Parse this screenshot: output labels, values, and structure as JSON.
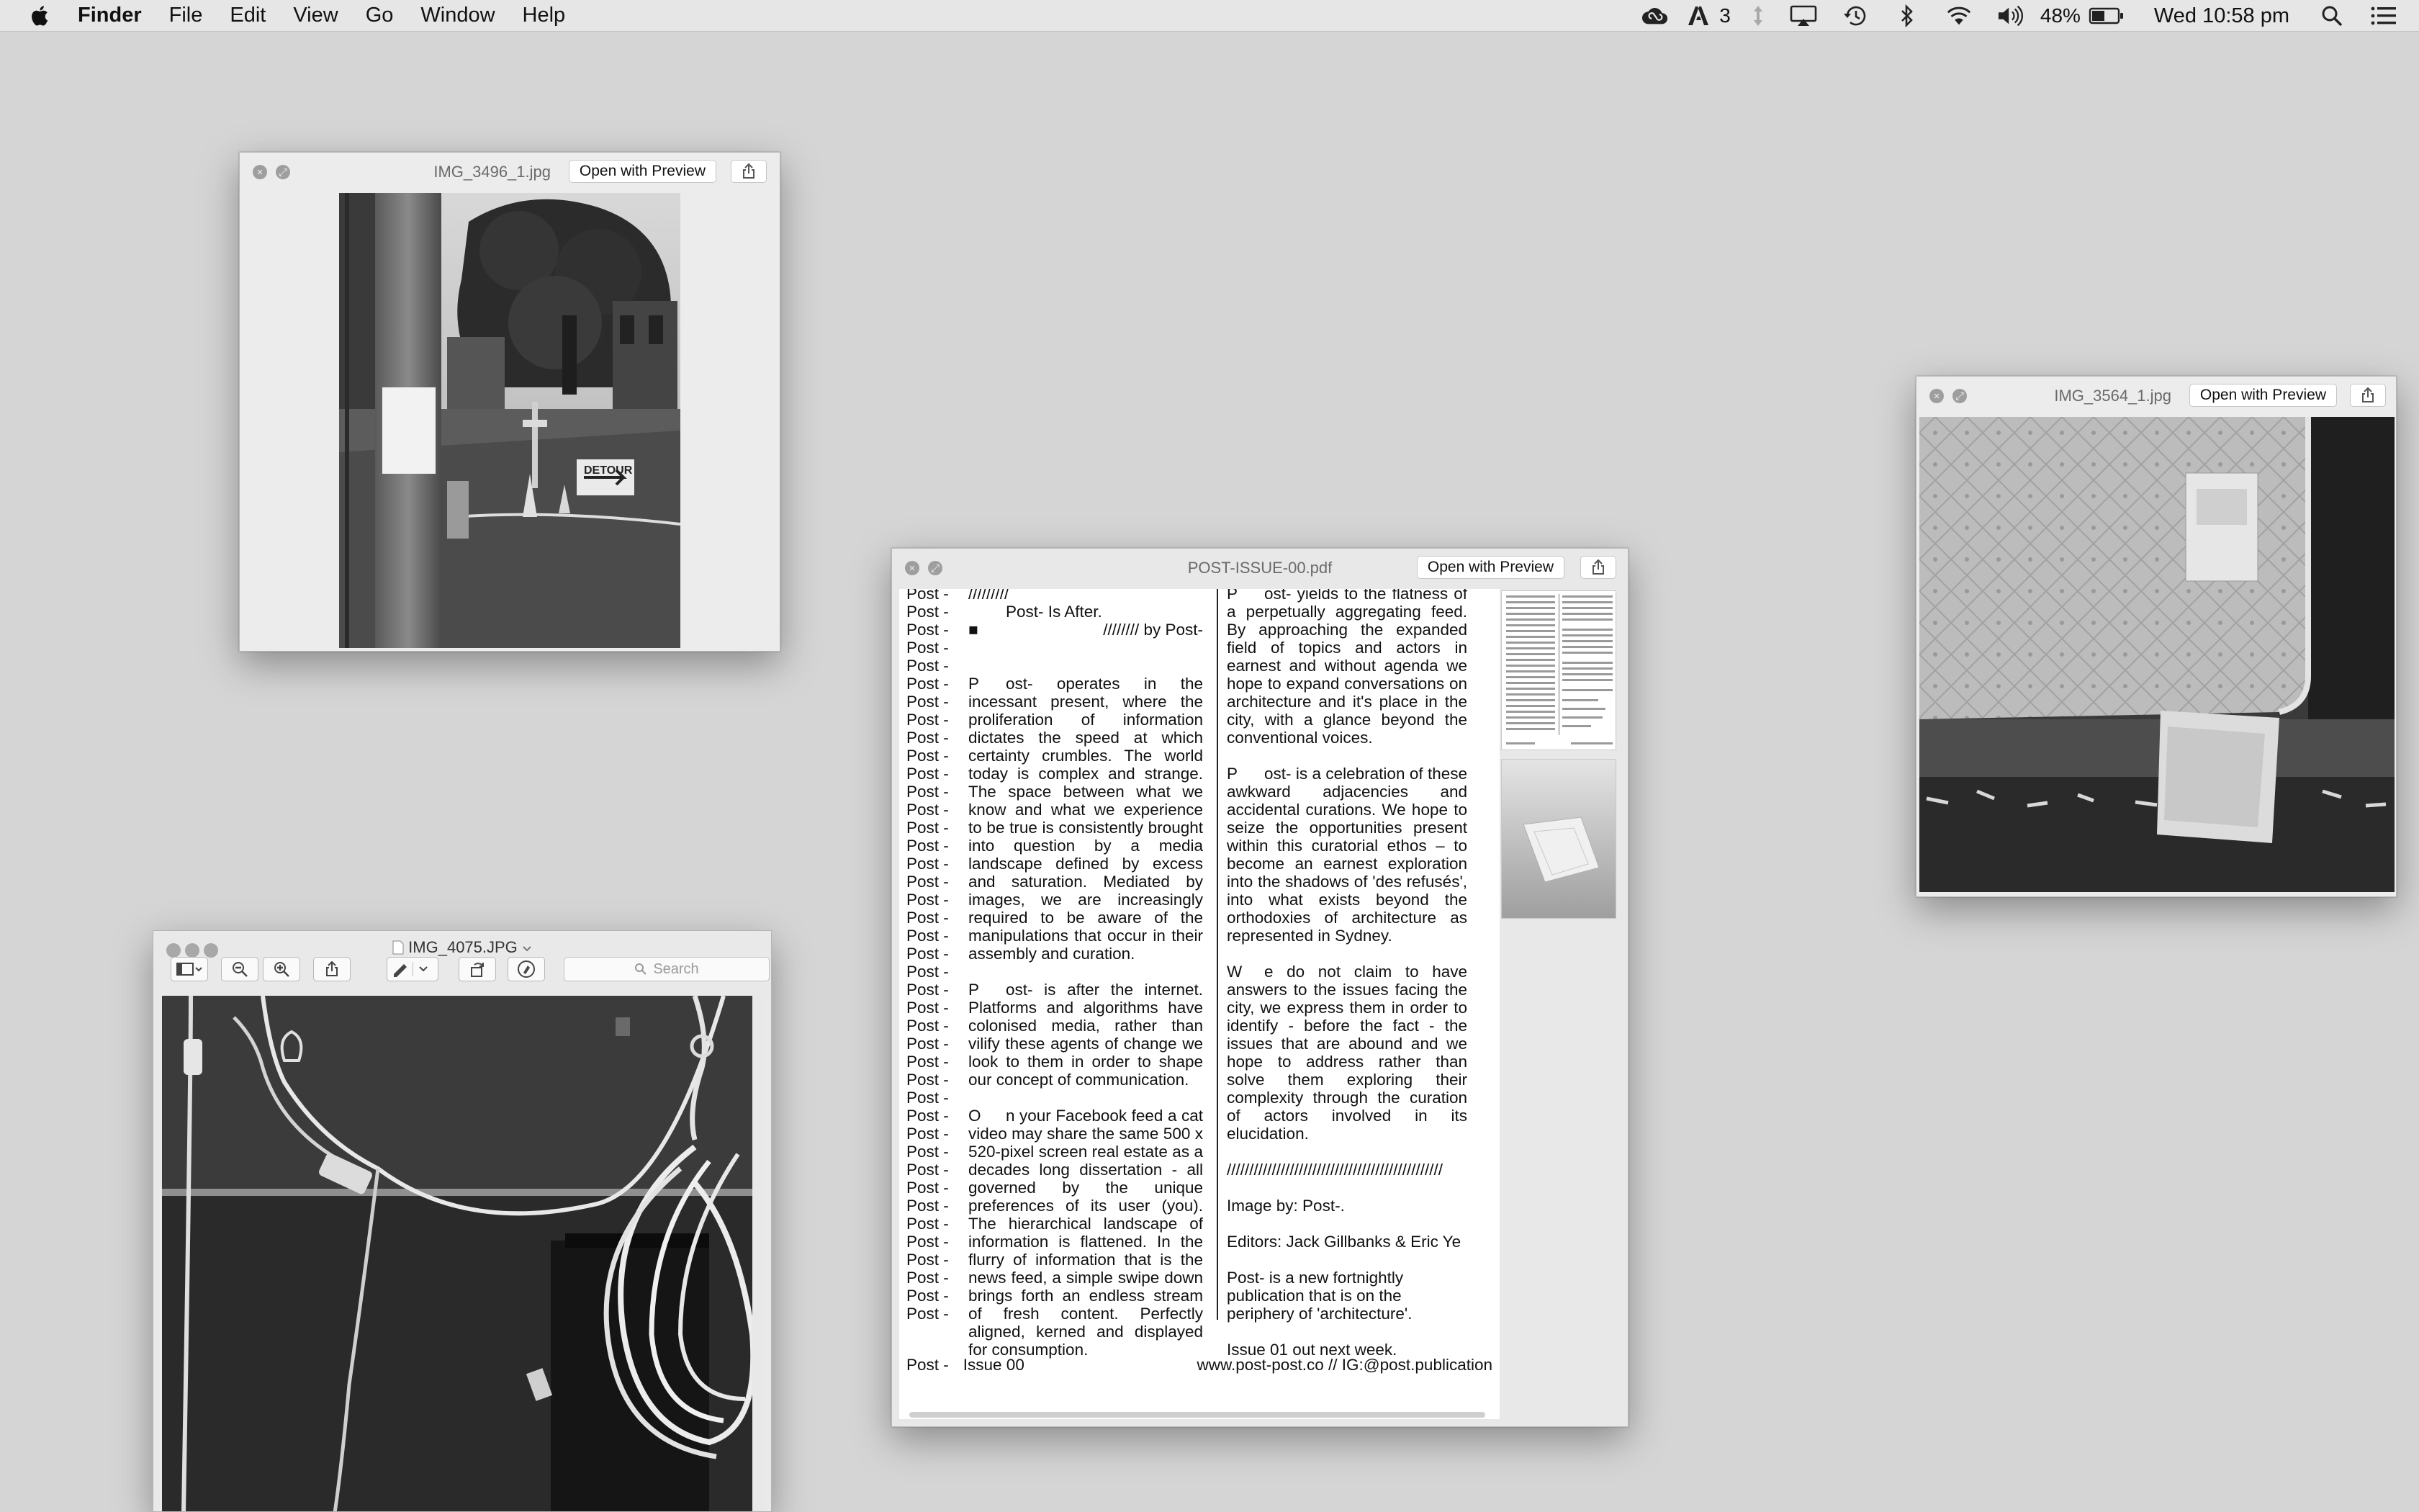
{
  "menubar": {
    "app_name": "Finder",
    "menus": [
      "File",
      "Edit",
      "View",
      "Go",
      "Window",
      "Help"
    ],
    "adobe_count": "3",
    "battery_percent": "48%",
    "clock": "Wed 10:58 pm"
  },
  "icons": {
    "apple": "apple-logo-icon",
    "cloud": "creative-cloud-icon",
    "adobe": "adobe-icon",
    "sync": "sync-arrows-icon",
    "airplay": "airplay-icon",
    "time_machine": "time-machine-icon",
    "bluetooth": "bluetooth-icon",
    "wifi": "wifi-icon",
    "volume": "volume-icon",
    "battery": "battery-icon",
    "spotlight": "spotlight-search-icon",
    "notification_center": "notification-center-icon"
  },
  "quicklook_windows": [
    {
      "filename": "IMG_3496_1.jpg",
      "open_label": "Open with Preview"
    },
    {
      "filename": "IMG_3564_1.jpg",
      "open_label": "Open with Preview"
    },
    {
      "filename": "POST-ISSUE-00.pdf",
      "open_label": "Open with Preview"
    }
  ],
  "preview_window": {
    "title": "IMG_4075.JPG",
    "search_placeholder": "Search"
  },
  "pdf": {
    "row_label": "Post -",
    "col1": {
      "line1": "/////////",
      "line2": "Post- Is After.",
      "line3_a": "■",
      "line3_b": "//////// by Post-",
      "para1_cap": "P",
      "para1": "ost- operates in the incessant present, where the proliferation of information dictates the speed at which certainty crumbles. The world today is complex and strange. The space between what we know and what we experience to be true is consistently brought into question by a media landscape defined by excess and saturation. Mediated by images, we are increasingly required to be aware of the manipulations that occur in their assembly and curation.",
      "para2_cap": "P",
      "para2": "ost- is after the internet. Platforms and algorithms have colonised media, rather than vilify these agents of change we look to them in order to shape our concept of communication.",
      "para3_cap": "O",
      "para3": "n your Facebook feed a cat video may share the same 500 x 520-pixel screen real estate as a decades long dissertation - all governed by the unique preferences of its user (you). The hierarchical landscape of information is flattened. In the flurry of information that is the news feed, a simple swipe down brings forth an endless stream of fresh content. Perfectly aligned, kerned and displayed for consumption."
    },
    "col2": {
      "para1_cap": "P",
      "para1": "ost- yields to the flatness of a perpetually aggregating feed. By approaching the expanded field of topics and actors in earnest and without agenda we hope to expand conversations on architecture and it's place in the city, with a glance beyond the conventional voices.",
      "para2_cap": "P",
      "para2": "ost- is a celebration of these awkward adjacencies and accidental curations. We hope to seize the opportunities present within this curatorial ethos – to become an earnest exploration into the shadows of 'des refusés', into what exists beyond the orthodoxies of architecture as represented in Sydney.",
      "para3_cap": "W",
      "para3": "e do not claim to have answers to the issues facing the city, we express them in order to identify - before the fact - the issues that are abound and we hope to address rather than solve them exploring their complexity through the curation of actors involved in its elucidation.",
      "slashes": "////////////////////////////////////////////////",
      "image_credit": "Image by: Post-.",
      "editors": "Editors: Jack Gillbanks & Eric Ye",
      "about": "Post- is a new fortnightly publication that is on the periphery of 'architecture'.",
      "next_issue": "Issue 01 out next week."
    },
    "footer_left_a": "Post -",
    "footer_left_b": "Issue 00",
    "footer_right": "www.post-post.co  //  IG:@post.publication"
  }
}
